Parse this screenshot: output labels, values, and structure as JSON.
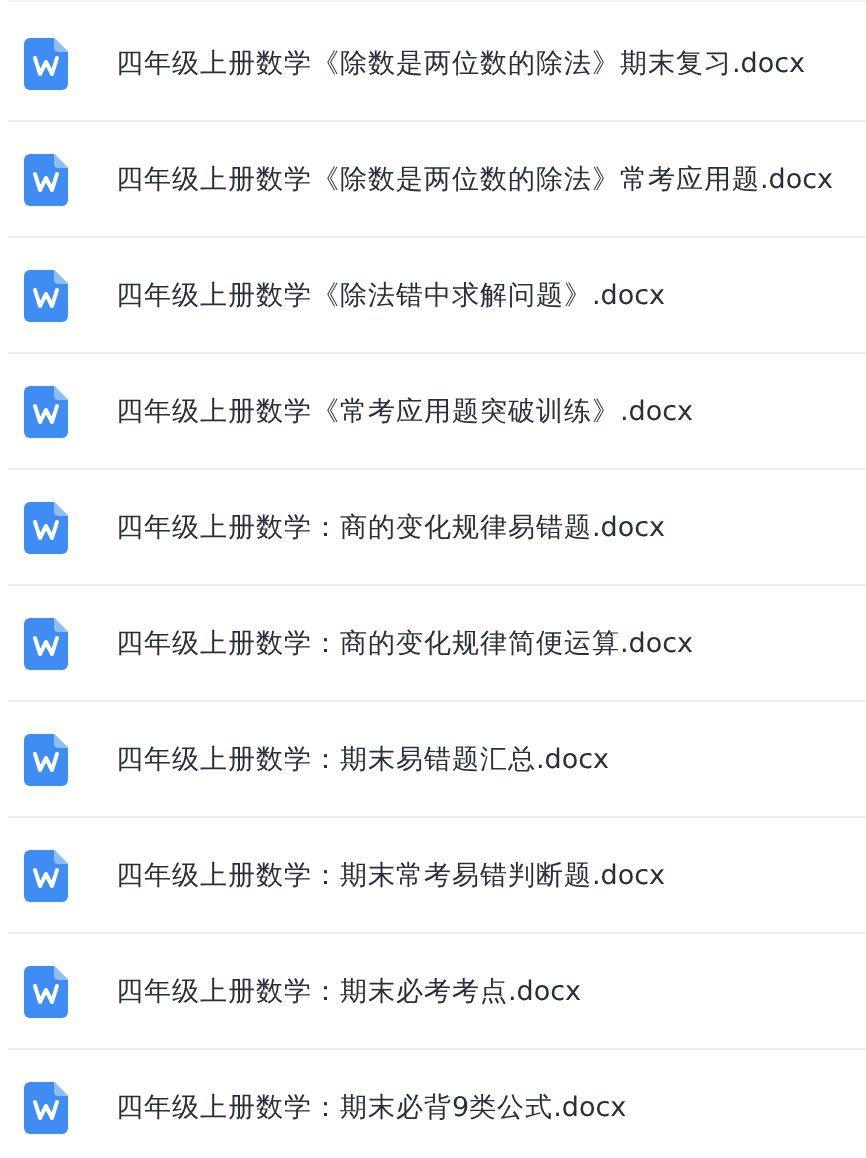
{
  "files": [
    {
      "name": "四年级上册数学《除数是两位数的除法》期末复习.docx"
    },
    {
      "name": "四年级上册数学《除数是两位数的除法》常考应用题.docx"
    },
    {
      "name": "四年级上册数学《除法错中求解问题》.docx"
    },
    {
      "name": "四年级上册数学《常考应用题突破训练》.docx"
    },
    {
      "name": "四年级上册数学：商的变化规律易错题.docx"
    },
    {
      "name": "四年级上册数学：商的变化规律简便运算.docx"
    },
    {
      "name": "四年级上册数学：期末易错题汇总.docx"
    },
    {
      "name": "四年级上册数学：期末常考易错判断题.docx"
    },
    {
      "name": "四年级上册数学：期末必考考点.docx"
    },
    {
      "name": "四年级上册数学：期末必背9类公式.docx"
    }
  ]
}
